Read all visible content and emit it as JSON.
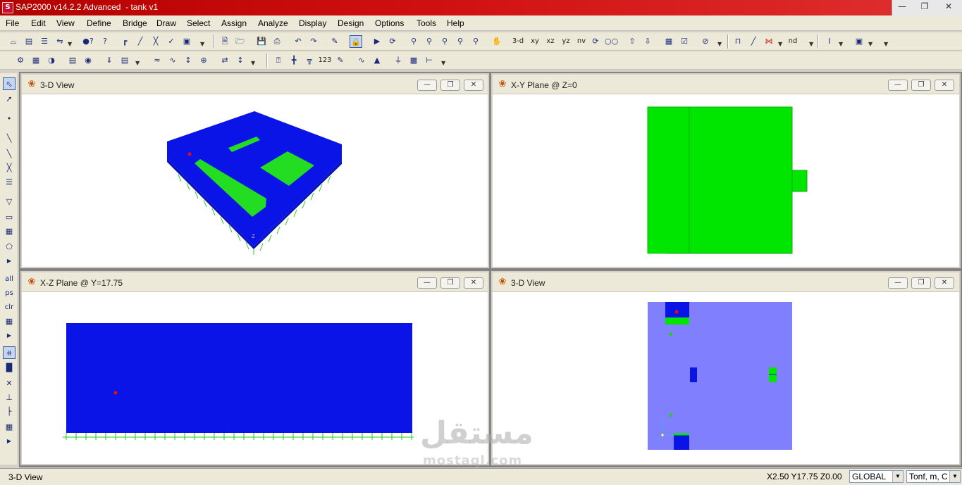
{
  "window": {
    "title": "SAP2000 v14.2.2 Advanced  - tank v1"
  },
  "menu": [
    "File",
    "Edit",
    "View",
    "Define",
    "Bridge",
    "Draw",
    "Select",
    "Assign",
    "Analyze",
    "Display",
    "Design",
    "Options",
    "Tools",
    "Help"
  ],
  "toolbar": {
    "view_3d": "3-d",
    "view_xy": "xy",
    "view_xz": "xz",
    "view_yz": "yz",
    "view_nv": "nv",
    "view_nd": "nd"
  },
  "left_toolbar": {
    "all": "all",
    "ps": "ps",
    "clr": "clr"
  },
  "views": [
    {
      "title": "3-D View"
    },
    {
      "title": "X-Y Plane @ Z=0"
    },
    {
      "title": "X-Z Plane @ Y=17.75"
    },
    {
      "title": "3-D View"
    }
  ],
  "status": {
    "active_view": "3-D View",
    "coords": "X2.50  Y17.75  Z0.00",
    "coord_system": "GLOBAL",
    "units": "Tonf, m, C"
  },
  "watermark": {
    "arabic": "مستقل",
    "latin": "mostaql.com"
  },
  "colors": {
    "shell": "#0a14e6",
    "opening": "#00e600",
    "restraint": "#22cc22",
    "light_blue": "#8080ff",
    "title_bar": "#c81010"
  }
}
